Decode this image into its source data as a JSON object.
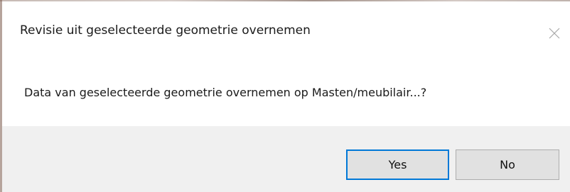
{
  "dialog": {
    "title": "Revisie uit geselecteerde geometrie overnemen",
    "message": "Data van geselecteerde geometrie overnemen op Masten/meubilair...?",
    "close_icon": "close-icon",
    "buttons": {
      "yes_label": "Yes",
      "no_label": "No"
    }
  },
  "colors": {
    "footer_bg": "#f0f0f0",
    "button_bg": "#e1e1e1",
    "default_button_border": "#0078d7"
  }
}
